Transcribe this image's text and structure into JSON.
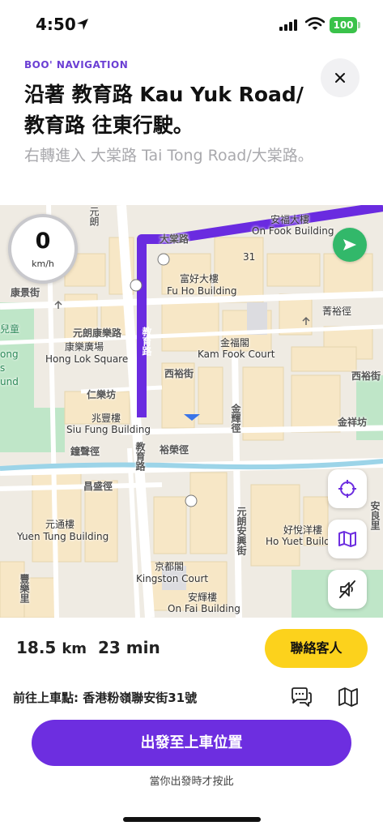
{
  "status_bar": {
    "time": "4:50",
    "battery": "100",
    "icons": [
      "location-arrow-icon",
      "signal-icon",
      "wifi-icon",
      "battery-icon"
    ],
    "battery_color": "#3ac24a"
  },
  "header": {
    "brand_label": "BOO' NAVIGATION",
    "instruction": "沿著 教育路 Kau Yuk Road/教育路 往東行駛。",
    "next_instruction": "右轉進入 大棠路 Tai Tong Road/大棠路。",
    "close_icon": "close-icon"
  },
  "map": {
    "speed": {
      "value": "0",
      "unit": "km/h"
    },
    "route_color": "#6a2be0",
    "labels": {
      "yuen_long_road": "元朗",
      "tai_tong_road": "大棠路",
      "on_fook_zh": "安福大樓",
      "on_fook_en": "On Fook Building",
      "number_31": "31",
      "fu_ho_zh": "富好大樓",
      "fu_ho_en": "Fu Ho Building",
      "hong_king_st": "康景街",
      "yuen_long_hong_fang": "元朗康樂路",
      "hong_lok_zh": "康樂廣場",
      "hong_lok_en": "Hong Lok Square",
      "kam_fook_zh": "金福閣",
      "kam_fook_en": "Kam Fook Court",
      "kau_yuk_road": "教育路",
      "sai_yu_st": "西裕街",
      "tsing_yu": "菁裕徑",
      "sai_yu_st_2": "西裕街",
      "yan_lok_fong": "仁樂坊",
      "siu_fung_zh": "兆豐樓",
      "siu_fung_en": "Siu Fung Building",
      "kam_wai_path": "金輝徑",
      "kam_cheung_fong": "金祥坊",
      "chung_sing_path": "鐘聲徑",
      "kau_yuk_road_2": "教育路",
      "yu_fat_path": "裕榮徑",
      "cheong_shing_path": "昌盛徑",
      "yuen_tung_zh": "元通樓",
      "yuen_tung_en": "Yuen Tung Building",
      "yuen_long_on_hing": "元朗安興街",
      "ho_yuet_zh": "好悅洋樓",
      "ho_yuet_en": "Ho Yuet Build",
      "on_lok_tsuen": "安良里",
      "king_tou_zh": "京都閣",
      "kingston_court": "Kingston Court",
      "on_fai_zh": "安輝樓",
      "on_fai_en": "On Fai Building",
      "fung_lok_lei": "豐樂里",
      "park_zh": "兒童",
      "park_en_1": "ong",
      "park_en_2": "s",
      "park_en_3": "und"
    },
    "controls": [
      "recenter-icon",
      "map-overview-icon",
      "mute-icon"
    ]
  },
  "trip": {
    "distance_value": "18.5",
    "distance_unit": "km",
    "duration": "23 min",
    "contact_label": "聯絡客人",
    "pickup_label": "前往上車點: 香港粉嶺聯安街31號",
    "depart_label": "出發至上車位置",
    "hint": "當你出發時才按此",
    "accent_color": "#6d2ee0",
    "contact_color": "#fcd21c"
  }
}
